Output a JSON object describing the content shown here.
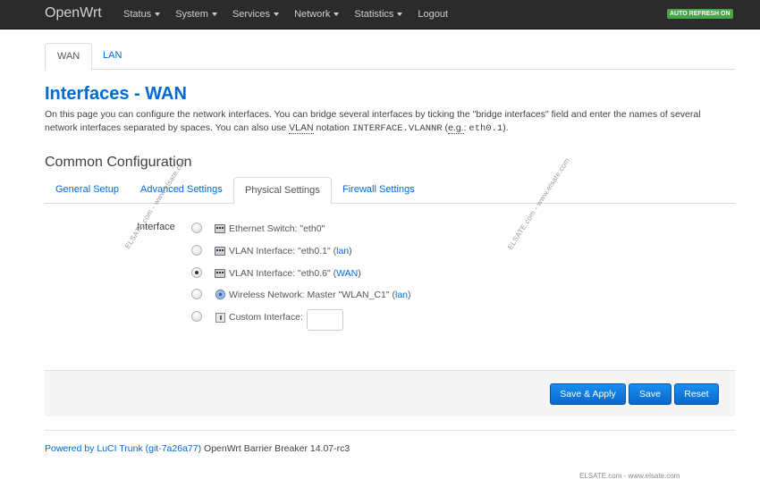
{
  "navbar": {
    "brand": "OpenWrt",
    "menu": [
      {
        "label": "Status",
        "dropdown": true
      },
      {
        "label": "System",
        "dropdown": true
      },
      {
        "label": "Services",
        "dropdown": true
      },
      {
        "label": "Network",
        "dropdown": true
      },
      {
        "label": "Statistics",
        "dropdown": true
      },
      {
        "label": "Logout",
        "dropdown": false
      }
    ],
    "auto_refresh": "AUTO REFRESH ON"
  },
  "top_tabs": [
    {
      "label": "WAN",
      "active": true
    },
    {
      "label": "LAN",
      "active": false
    }
  ],
  "page": {
    "title": "Interfaces - WAN",
    "desc_1": "On this page you can configure the network interfaces. You can bridge several interfaces by ticking the \"bridge interfaces\" field and enter the names of several network interfaces separated by spaces. You can also use ",
    "desc_vlan": "VLAN",
    "desc_2": " notation ",
    "desc_code1": "INTERFACE.VLANNR",
    "desc_3": " (",
    "desc_eg": "e.g.",
    "desc_4": ": ",
    "desc_code2": "eth0.1",
    "desc_5": ")."
  },
  "common_config": {
    "title": "Common Configuration",
    "tabs": [
      {
        "label": "General Setup",
        "active": false
      },
      {
        "label": "Advanced Settings",
        "active": false
      },
      {
        "label": "Physical Settings",
        "active": true
      },
      {
        "label": "Firewall Settings",
        "active": false
      }
    ]
  },
  "interface_field": {
    "label": "Interface",
    "options": [
      {
        "icon": "ethernet-switch-icon",
        "text": "Ethernet Switch: \"eth0\"",
        "link": "",
        "checked": false
      },
      {
        "icon": "ethernet-port-icon",
        "text": "VLAN Interface: \"eth0.1\" (",
        "link": "lan",
        "after": ")",
        "checked": false
      },
      {
        "icon": "ethernet-port-icon",
        "text": "VLAN Interface: \"eth0.6\" (",
        "link": "WAN",
        "after": ")",
        "checked": true
      },
      {
        "icon": "wifi-icon",
        "text": "Wireless Network: Master \"WLAN_C1\" (",
        "link": "lan",
        "after": ")",
        "checked": false
      },
      {
        "icon": "custom-interface-icon",
        "text": "Custom Interface:",
        "link": "",
        "checked": false
      }
    ],
    "custom_value": ""
  },
  "actions": {
    "save_apply": "Save & Apply",
    "save": "Save",
    "reset": "Reset"
  },
  "footer": {
    "link": "Powered by LuCI Trunk (git-7a26a77)",
    "text": " OpenWrt Barrier Breaker 14.07-rc3"
  },
  "watermarks": {
    "diag": "ELSATE.com - www.elsate.com",
    "bottom": "ELSATE.com - www.elsate.com"
  },
  "colors": {
    "navbar_bg": "#2b2b2b",
    "link": "#0069d6",
    "button": "#0769c9",
    "auto_refresh_badge": "#46a546"
  }
}
